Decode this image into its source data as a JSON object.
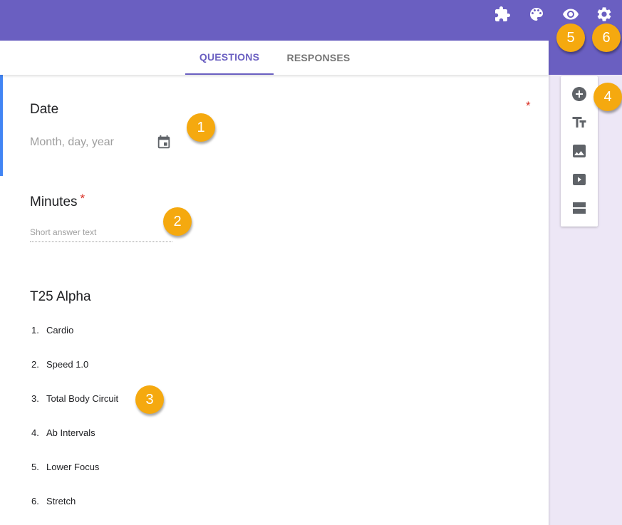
{
  "header": {
    "background_color": "#6a5fc1",
    "icons": [
      {
        "name": "addons-icon",
        "label": "Add-ons"
      },
      {
        "name": "palette-icon",
        "label": "Customize theme"
      },
      {
        "name": "eye-icon",
        "label": "Preview"
      },
      {
        "name": "gear-icon",
        "label": "Settings"
      }
    ]
  },
  "tabs": {
    "questions": "QUESTIONS",
    "responses": "RESPONSES",
    "active": "QUESTIONS"
  },
  "form": {
    "date_question": {
      "title": "Date",
      "required_marker": "*",
      "placeholder": "Month, day, year",
      "icon": "calendar-icon"
    },
    "minutes_question": {
      "title": "Minutes",
      "required_marker": "*",
      "placeholder": "Short answer text"
    },
    "t25_section": {
      "title": "T25 Alpha",
      "items": [
        {
          "num": "1.",
          "label": "Cardio"
        },
        {
          "num": "2.",
          "label": "Speed 1.0"
        },
        {
          "num": "3.",
          "label": "Total Body Circuit"
        },
        {
          "num": "4.",
          "label": "Ab Intervals"
        },
        {
          "num": "5.",
          "label": "Lower Focus"
        },
        {
          "num": "6.",
          "label": "Stretch"
        }
      ]
    }
  },
  "toolbar": {
    "items": [
      {
        "name": "add-question-icon",
        "label": "Add question"
      },
      {
        "name": "title-text-icon",
        "label": "Add title and description"
      },
      {
        "name": "image-icon",
        "label": "Add image"
      },
      {
        "name": "video-icon",
        "label": "Add video"
      },
      {
        "name": "section-icon",
        "label": "Add section"
      }
    ]
  },
  "callouts": [
    "1",
    "2",
    "3",
    "4",
    "5",
    "6"
  ],
  "colors": {
    "accent": "#6a5fc1",
    "active_question_bar": "#4285f4",
    "required_star": "#d93025",
    "callout": "#f5a90f",
    "page_background": "#ede7f6"
  }
}
